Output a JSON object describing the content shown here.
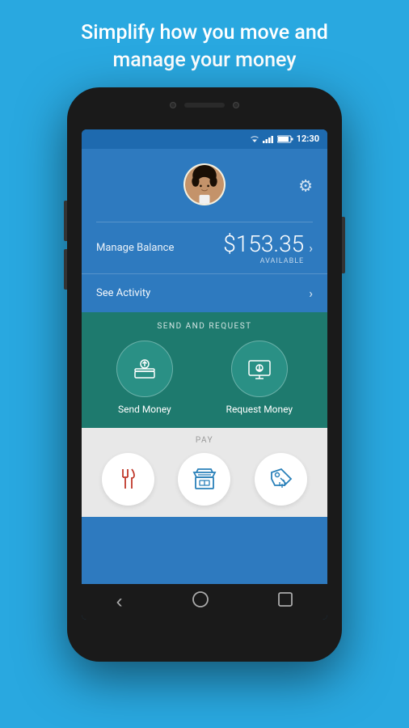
{
  "page": {
    "title_line1": "Simplify how you move and",
    "title_line2": "manage your money",
    "background_color": "#29a8e0"
  },
  "status_bar": {
    "time": "12:30",
    "wifi": "▼",
    "signal": "▲▲▲",
    "battery": "🔋"
  },
  "header": {
    "gear_icon": "⚙"
  },
  "balance": {
    "manage_label": "Manage Balance",
    "amount": "$153.35",
    "available_label": "AVAILABLE",
    "arrow": "›"
  },
  "activity": {
    "label": "See Activity",
    "arrow": "›"
  },
  "send_request": {
    "section_title": "SEND AND REQUEST",
    "send_label": "Send Money",
    "request_label": "Request Money"
  },
  "pay": {
    "section_title": "PAY",
    "btn1_label": "Restaurants",
    "btn2_label": "Stores",
    "btn3_label": "Tickets"
  },
  "nav": {
    "back": "‹",
    "home": "○",
    "recent": "□"
  }
}
